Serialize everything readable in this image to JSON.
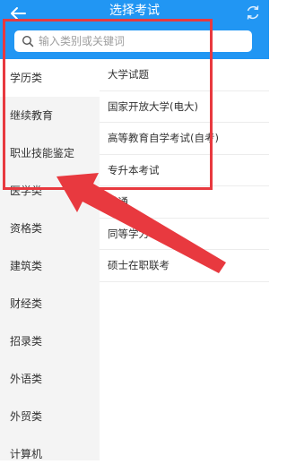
{
  "header": {
    "title": "选择考试"
  },
  "search": {
    "placeholder": "输入类别或关键词",
    "value": ""
  },
  "sidebar": {
    "items": [
      {
        "label": "学历类",
        "active": true
      },
      {
        "label": "继续教育"
      },
      {
        "label": "职业技能鉴定"
      },
      {
        "label": "医学类"
      },
      {
        "label": "资格类"
      },
      {
        "label": "建筑类"
      },
      {
        "label": "财经类"
      },
      {
        "label": "招录类"
      },
      {
        "label": "外语类"
      },
      {
        "label": "外贸类"
      },
      {
        "label": "计算机"
      }
    ]
  },
  "exams": {
    "items": [
      {
        "label": "大学试题"
      },
      {
        "label": "国家开放大学(电大)"
      },
      {
        "label": "高等教育自学考试(自考)"
      },
      {
        "label": "专升本考试"
      },
      {
        "label": "普通"
      },
      {
        "label": "同等学力申硕"
      },
      {
        "label": "硕士在职联考"
      }
    ]
  },
  "colors": {
    "header": "#2196f3",
    "annotation": "#e8393f",
    "sidebar": "#f4f4f4"
  },
  "icons": [
    "back-arrow-icon",
    "refresh-icon",
    "search-icon"
  ]
}
